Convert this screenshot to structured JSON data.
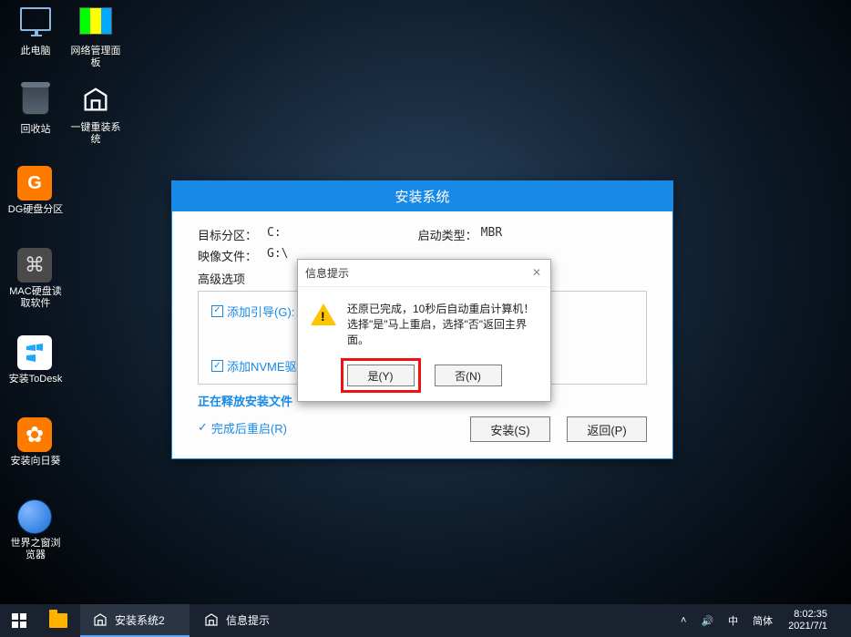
{
  "desktop_icons": {
    "pc": "此电脑",
    "netpanel": "网络管理面板",
    "recycle": "回收站",
    "onekey": "一键重装系统",
    "dg": "DG硬盘分区",
    "mac": "MAC硬盘读取软件",
    "todesk": "安装ToDesk",
    "sunflower": "安装向日葵",
    "browser": "世界之窗浏览器"
  },
  "installer": {
    "title": "安装系统",
    "target_label": "目标分区：",
    "target_value": "C:",
    "boot_label": "启动类型：",
    "boot_value": "MBR",
    "image_label": "映像文件：",
    "image_value": "G:\\",
    "adv_label": "高级选项",
    "cb_boot": "添加引导(G):",
    "cb_nvme": "添加NVME驱",
    "progress": "正在释放安装文件",
    "cb_restart": "完成后重启(R)",
    "btn_install": "安装(S)",
    "btn_back": "返回(P)"
  },
  "msgbox": {
    "title": "信息提示",
    "line1": "还原已完成，10秒后自动重启计算机！",
    "line2": "选择\"是\"马上重启，选择\"否\"返回主界面。",
    "yes": "是(Y)",
    "no": "否(N)"
  },
  "taskbar": {
    "app1": "安装系统2",
    "app2": "信息提示"
  },
  "tray": {
    "ime1": "中",
    "ime2": "简体",
    "time": "8:02:35",
    "date": "2021/7/1",
    "chevron": "˄",
    "sound": "🔊"
  }
}
